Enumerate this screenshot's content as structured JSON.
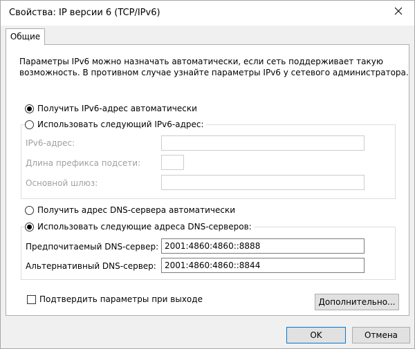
{
  "window": {
    "title": "Свойства: IP версии 6 (TCP/IPv6)"
  },
  "tabs": [
    {
      "label": "Общие"
    }
  ],
  "general": {
    "description_line1": "Параметры IPv6 можно назначать автоматически, если сеть поддерживает такую",
    "description_line2": "возможность. В противном случае узнайте параметры IPv6 у сетевого администратора.",
    "ip_auto_label": "Получить IPv6-адрес автоматически",
    "ip_manual_label": "Использовать следующий IPv6-адрес:",
    "ip_mode": "auto",
    "ipv6_address_label": "IPv6-адрес:",
    "ipv6_address_value": "",
    "prefix_length_label": "Длина префикса подсети:",
    "prefix_length_value": "",
    "gateway_label": "Основной шлюз:",
    "gateway_value": "",
    "dns_auto_label": "Получить адрес DNS-сервера автоматически",
    "dns_manual_label": "Использовать следующие адреса DNS-серверов:",
    "dns_mode": "manual",
    "preferred_dns_label": "Предпочитаемый DNS-сервер:",
    "preferred_dns_value": "2001:4860:4860::8888",
    "alternate_dns_label": "Альтернативный DNS-сервер:",
    "alternate_dns_value": "2001:4860:4860::8844",
    "validate_on_exit_label": "Подтвердить параметры при выходе",
    "validate_on_exit_checked": false,
    "advanced_button": "Дополнительно..."
  },
  "footer": {
    "ok_button": "OK",
    "cancel_button": "Отмена"
  }
}
